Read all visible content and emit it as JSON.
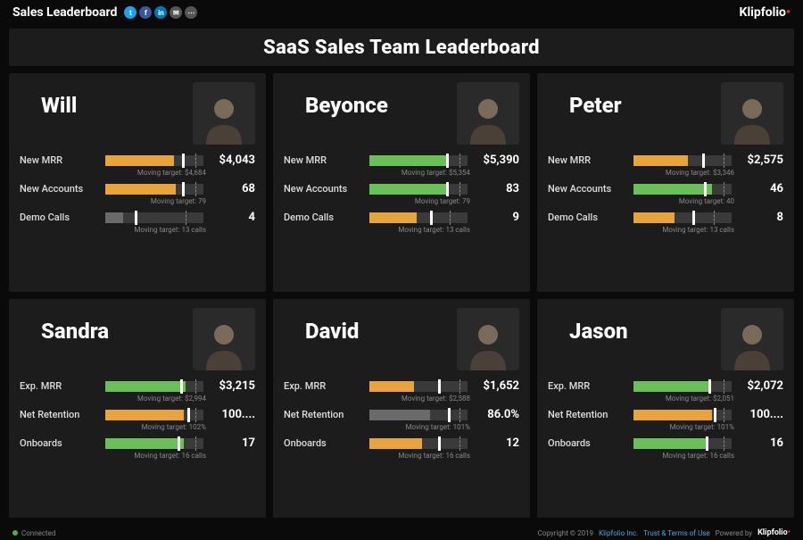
{
  "topbar": {
    "title": "Sales Leaderboard",
    "brand": "Klipfolio",
    "social": [
      {
        "bg": "#1da1f2",
        "glyph": "t"
      },
      {
        "bg": "#3b5998",
        "glyph": "f"
      },
      {
        "bg": "#0077b5",
        "glyph": "in"
      },
      {
        "bg": "#555",
        "glyph": "✉"
      },
      {
        "bg": "#555",
        "glyph": "⋯"
      }
    ]
  },
  "header": {
    "title": "SaaS Sales Team Leaderboard"
  },
  "chart_data": {
    "type": "bar",
    "title": "SaaS Sales Team Leaderboard",
    "people": [
      {
        "name": "Will",
        "metrics": [
          {
            "label": "New MRR",
            "value": "$4,043",
            "target": "Moving target: $4,684",
            "fill": 70,
            "tick": 78,
            "dash": 92,
            "color": "orange"
          },
          {
            "label": "New Accounts",
            "value": "68",
            "target": "Moving target: 79",
            "fill": 72,
            "tick": 78,
            "dash": 92,
            "color": "orange"
          },
          {
            "label": "Demo Calls",
            "value": "4",
            "target": "Moving target: 13 calls",
            "fill": 18,
            "tick": 30,
            "dash": 82,
            "color": "gray"
          }
        ]
      },
      {
        "name": "Beyonce",
        "metrics": [
          {
            "label": "New MRR",
            "value": "$5,390",
            "target": "Moving target: $5,354",
            "fill": 80,
            "tick": 78,
            "dash": 92,
            "color": "green"
          },
          {
            "label": "New Accounts",
            "value": "83",
            "target": "Moving target: 79",
            "fill": 80,
            "tick": 78,
            "dash": 92,
            "color": "green"
          },
          {
            "label": "Demo Calls",
            "value": "9",
            "target": "Moving target: 13 calls",
            "fill": 48,
            "tick": 62,
            "dash": 82,
            "color": "orange"
          }
        ]
      },
      {
        "name": "Peter",
        "metrics": [
          {
            "label": "New MRR",
            "value": "$2,575",
            "target": "Moving target: $3,346",
            "fill": 55,
            "tick": 70,
            "dash": 92,
            "color": "orange"
          },
          {
            "label": "New Accounts",
            "value": "46",
            "target": "Moving target: 40",
            "fill": 80,
            "tick": 72,
            "dash": 92,
            "color": "green"
          },
          {
            "label": "Demo Calls",
            "value": "8",
            "target": "Moving target: 13 calls",
            "fill": 42,
            "tick": 60,
            "dash": 82,
            "color": "orange"
          }
        ]
      },
      {
        "name": "Sandra",
        "metrics": [
          {
            "label": "Exp. MRR",
            "value": "$3,215",
            "target": "Moving target: $2,994",
            "fill": 82,
            "tick": 76,
            "dash": 92,
            "color": "green"
          },
          {
            "label": "Net Retention",
            "value": "100....",
            "target": "Moving target: 102%",
            "fill": 80,
            "tick": 84,
            "dash": 92,
            "color": "orange"
          },
          {
            "label": "Onboards",
            "value": "17",
            "target": "Moving target: 16 calls",
            "fill": 80,
            "tick": 74,
            "dash": 92,
            "color": "green"
          }
        ]
      },
      {
        "name": "David",
        "metrics": [
          {
            "label": "Exp. MRR",
            "value": "$1,652",
            "target": "Moving target: $2,588",
            "fill": 45,
            "tick": 70,
            "dash": 92,
            "color": "orange"
          },
          {
            "label": "Net Retention",
            "value": "86.0%",
            "target": "Moving target: 101%",
            "fill": 62,
            "tick": 80,
            "dash": 92,
            "color": "gray"
          },
          {
            "label": "Onboards",
            "value": "12",
            "target": "Moving target: 16 calls",
            "fill": 54,
            "tick": 70,
            "dash": 92,
            "color": "orange"
          }
        ]
      },
      {
        "name": "Jason",
        "metrics": [
          {
            "label": "Exp. MRR",
            "value": "$2,072",
            "target": "Moving target: $2,051",
            "fill": 78,
            "tick": 76,
            "dash": 92,
            "color": "green"
          },
          {
            "label": "Net Retention",
            "value": "100....",
            "target": "Moving target: 101%",
            "fill": 80,
            "tick": 82,
            "dash": 92,
            "color": "orange"
          },
          {
            "label": "Onboards",
            "value": "16",
            "target": "Moving target: 16 calls",
            "fill": 76,
            "tick": 74,
            "dash": 92,
            "color": "green"
          }
        ]
      }
    ]
  },
  "footer": {
    "connected": "Connected",
    "copyright": "Copyright © 2019",
    "company": "Klipfolio Inc.",
    "terms": "Trust & Terms of Use",
    "powered": "Powered by",
    "brand": "Klipfolio"
  }
}
